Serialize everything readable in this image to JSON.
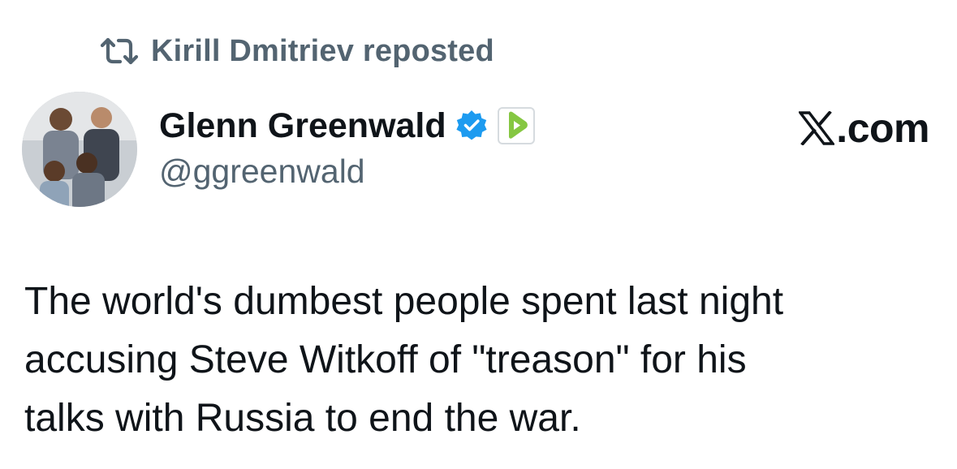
{
  "repost": {
    "icon": "repost-icon",
    "text": "Kirill Dmitriev reposted"
  },
  "author": {
    "avatar": "avatar-photo",
    "display_name": "Glenn Greenwald",
    "verified_icon": "verified-badge-icon",
    "affiliate_icon": "rumble-play-icon",
    "handle": "@ggreenwald"
  },
  "brand": {
    "logo": "x-logo-icon",
    "domain": ".com"
  },
  "tweet": {
    "text": "The world's dumbest people spent last night\naccusing Steve Witkoff of \"treason\" for his\ntalks with Russia to end the war."
  },
  "colors": {
    "text_primary": "#0f1419",
    "text_secondary": "#536471",
    "verified_blue": "#1d9bf0",
    "rumble_green": "#85c742"
  }
}
